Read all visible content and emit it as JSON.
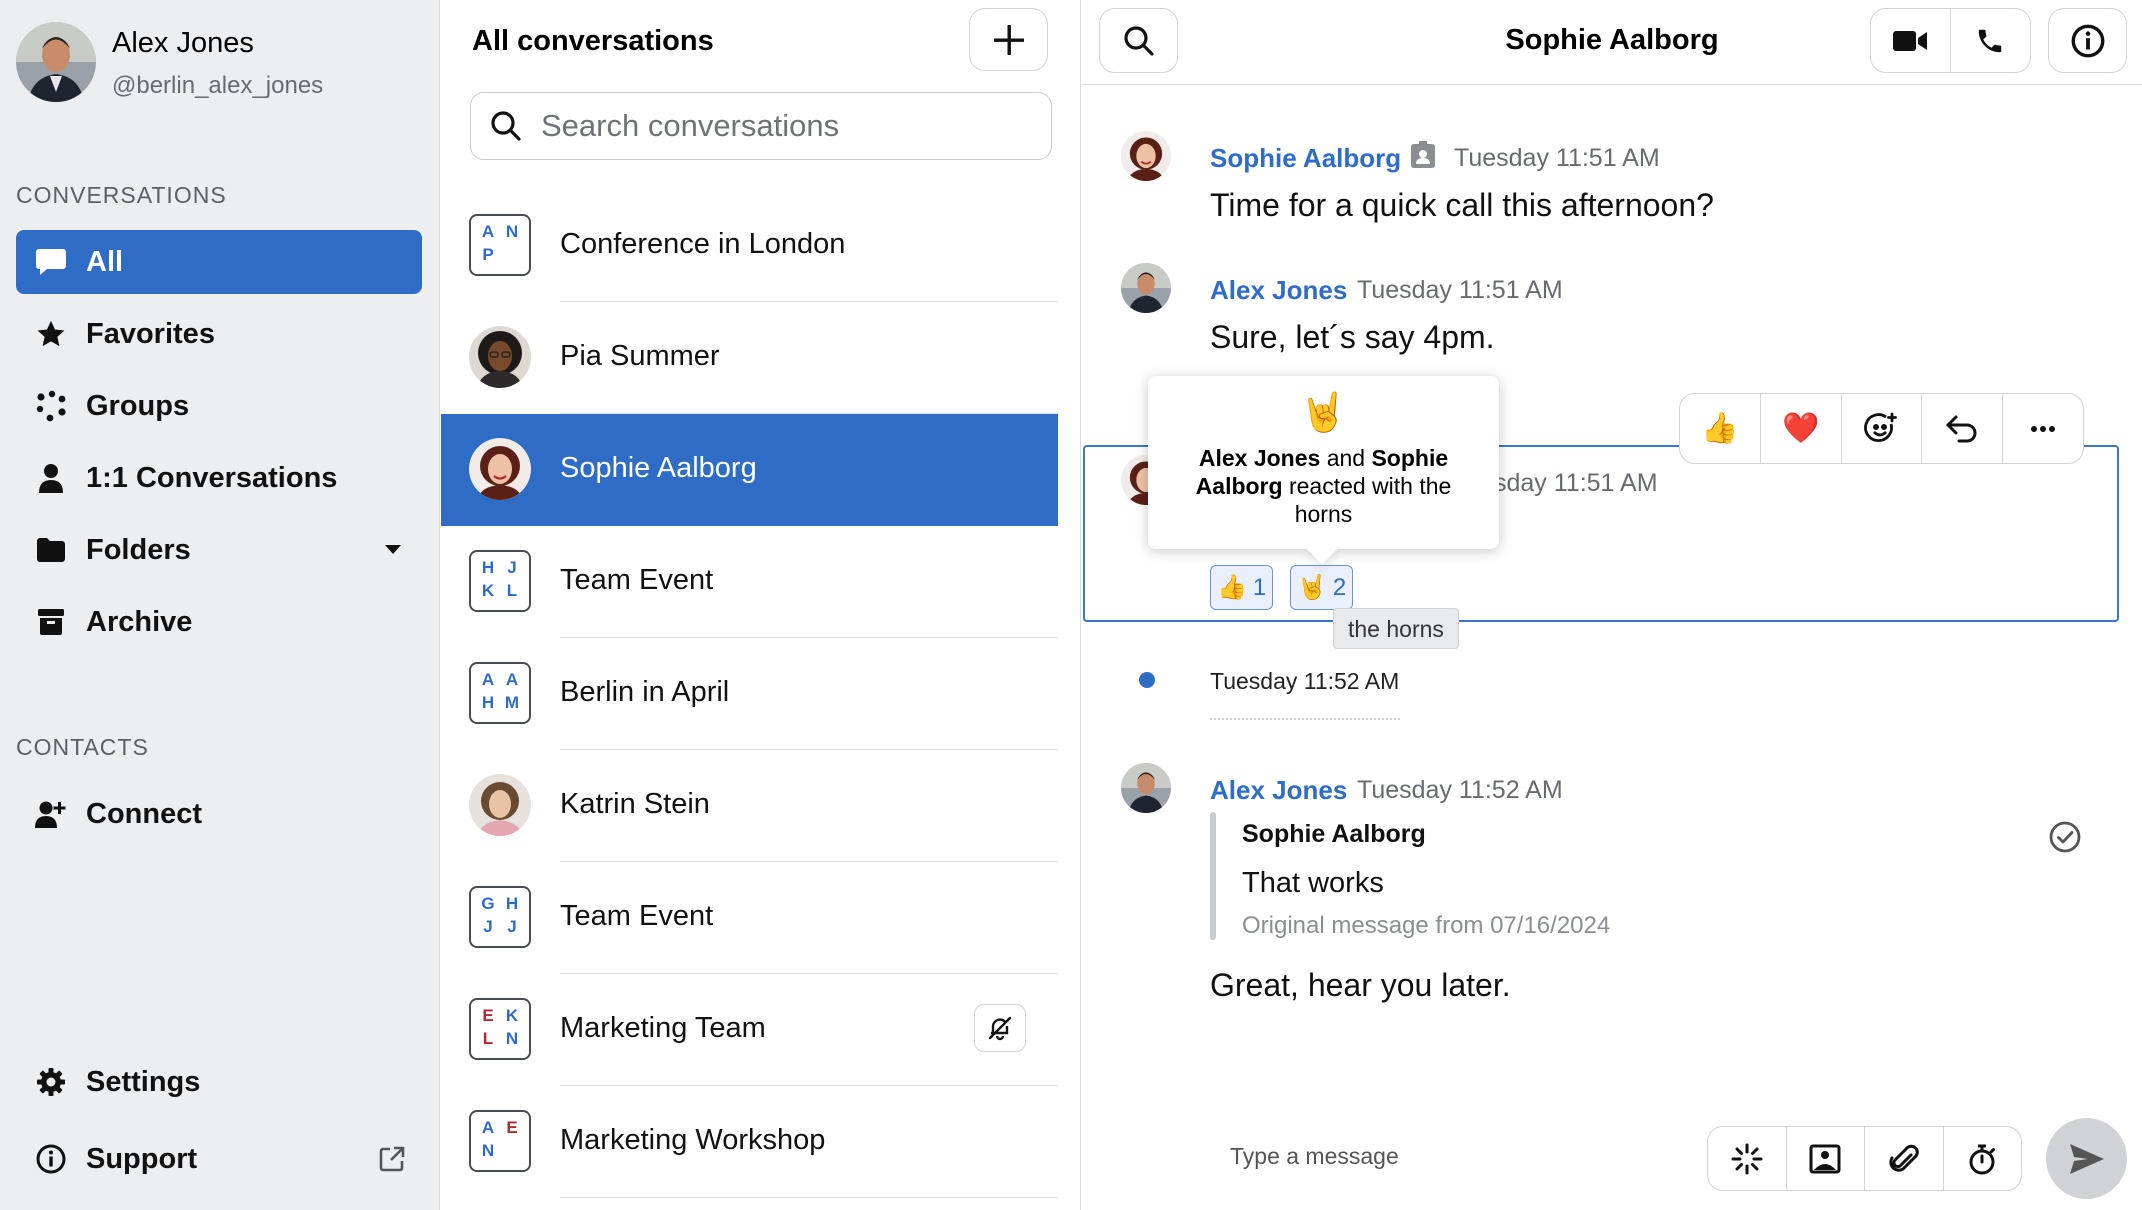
{
  "user": {
    "name": "Alex Jones",
    "handle": "@berlin_alex_jones"
  },
  "sidebar": {
    "conversations_heading": "CONVERSATIONS",
    "items": [
      {
        "label": "All",
        "icon": "chat-bubble-icon",
        "active": true
      },
      {
        "label": "Favorites",
        "icon": "star-icon"
      },
      {
        "label": "Groups",
        "icon": "groups-icon"
      },
      {
        "label": "1:1 Conversations",
        "icon": "person-icon"
      },
      {
        "label": "Folders",
        "icon": "folder-icon"
      },
      {
        "label": "Archive",
        "icon": "archive-icon"
      }
    ],
    "contacts_heading": "CONTACTS",
    "connect_label": "Connect",
    "settings_label": "Settings",
    "support_label": "Support"
  },
  "list": {
    "title": "All conversations",
    "search_placeholder": "Search conversations",
    "conversations": [
      {
        "name": "Conference in London",
        "initials": [
          "A",
          "N",
          "P",
          ""
        ]
      },
      {
        "name": "Pia Summer"
      },
      {
        "name": "Sophie Aalborg",
        "active": true
      },
      {
        "name": "Team Event",
        "initials": [
          "H",
          "J",
          "K",
          "L"
        ]
      },
      {
        "name": "Berlin in April",
        "initials": [
          "A",
          "A",
          "H",
          "M"
        ]
      },
      {
        "name": "Katrin Stein"
      },
      {
        "name": "Team Event",
        "initials": [
          "G",
          "H",
          "J",
          "J"
        ]
      },
      {
        "name": "Marketing Team",
        "initials": [
          "E",
          "K",
          "L",
          "N"
        ],
        "muted": true
      },
      {
        "name": "Marketing Workshop",
        "initials": [
          "A",
          "E",
          "N",
          ""
        ]
      }
    ]
  },
  "chat": {
    "title": "Sophie Aalborg",
    "messages": [
      {
        "sender": "Sophie Aalborg",
        "time": "Tuesday 11:51 AM",
        "text": "Time for a quick call this afternoon?"
      },
      {
        "sender": "Alex Jones",
        "time": "Tuesday 11:51 AM",
        "text": "Sure, let´s say 4pm."
      },
      {
        "time_partial": "sday 11:51 AM"
      }
    ],
    "reactions": [
      {
        "emoji": "👍",
        "count": "1"
      },
      {
        "emoji": "🤘",
        "count": "2"
      }
    ],
    "tooltip": {
      "emoji": "🤘",
      "name1": "Alex Jones",
      "and": "and",
      "name2": "Sophie Aalborg",
      "rest": "reacted with the horns"
    },
    "reaction_hint": "the horns",
    "actions": [
      {
        "emoji": "👍"
      },
      {
        "emoji": "❤️"
      }
    ],
    "day_separator": "Tuesday 11:52 AM",
    "reply": {
      "sender": "Alex Jones",
      "time": "Tuesday 11:52 AM",
      "quote_sender": "Sophie Aalborg",
      "quote_text": "That works",
      "quote_original": "Original message from 07/16/2024",
      "text": "Great, hear you later."
    },
    "composer_placeholder": "Type a message"
  },
  "colors": {
    "accent": "#2e6cc6",
    "initials_blue": "#2e6cc6",
    "initials_red": "#b2282c"
  }
}
